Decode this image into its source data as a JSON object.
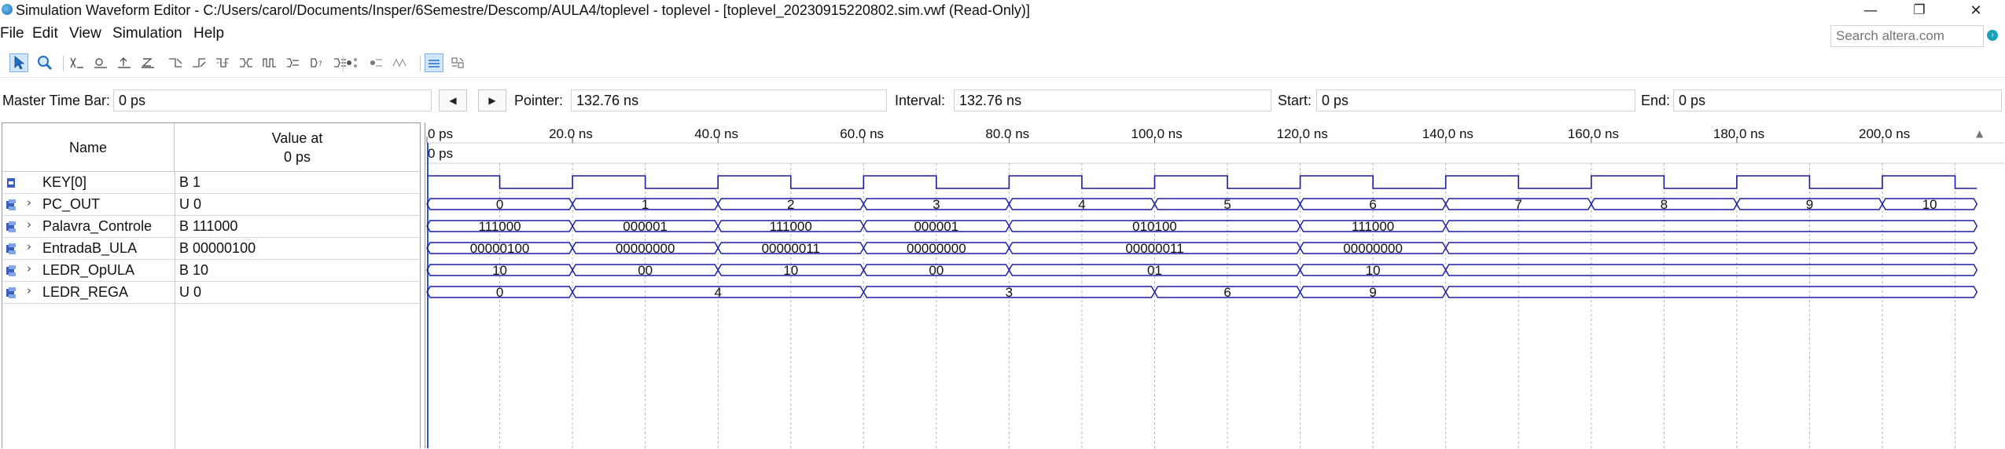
{
  "window": {
    "title": "Simulation Waveform Editor - C:/Users/carol/Documents/Insper/6Semestre/Descomp/AULA4/toplevel - toplevel - [toplevel_20230915220802.sim.vwf (Read-Only)]",
    "minimize": "—",
    "maximize": "❐",
    "close": "✕"
  },
  "menu": [
    "File",
    "Edit",
    "View",
    "Simulation",
    "Help"
  ],
  "search": {
    "placeholder": "Search altera.com"
  },
  "toolbar": {
    "icons": [
      "selection-tool-icon",
      "zoom-tool-icon",
      "forcing-unknown-icon",
      "forcing-low-icon",
      "forcing-high-icon",
      "forcing-high-impedance-icon",
      "weak-low-icon",
      "weak-high-icon",
      "invert-icon",
      "count-value-icon",
      "clock-icon",
      "random-values-icon",
      "value-icon",
      "snap-to-grid-icon",
      "grid-icon",
      "waveform-compare-icon",
      "settings-icon",
      "report-icon"
    ]
  },
  "timebar": {
    "master_label": "Master Time Bar:",
    "master_value": "0 ps",
    "prev": "◀",
    "next": "▶",
    "pointer_label": "Pointer:",
    "pointer_value": "132.76 ns",
    "interval_label": "Interval:",
    "interval_value": "132.76 ns",
    "start_label": "Start:",
    "start_value": "0 ps",
    "end_label": "End:",
    "end_value": "0 ps"
  },
  "signals_header": {
    "name": "Name",
    "value_line1": "Value at",
    "value_line2": "0 ps"
  },
  "signals": [
    {
      "name": "KEY[0]",
      "value": "B 1",
      "expandable": false,
      "icon": "input-pin-icon"
    },
    {
      "name": "PC_OUT",
      "value": "U 0",
      "expandable": true,
      "icon": "output-bus-icon"
    },
    {
      "name": "Palavra_Controle",
      "value": "B 111000",
      "expandable": true,
      "icon": "output-bus-icon"
    },
    {
      "name": "EntradaB_ULA",
      "value": "B 00000100",
      "expandable": true,
      "icon": "output-bus-icon"
    },
    {
      "name": "LEDR_OpULA",
      "value": "B 10",
      "expandable": true,
      "icon": "output-bus-icon"
    },
    {
      "name": "LEDR_REGA",
      "value": "U 0",
      "expandable": true,
      "icon": "output-bus-icon"
    }
  ],
  "timeline": {
    "ticks": [
      "0 ps",
      "20.0 ns",
      "40.0 ns",
      "60.0 ns",
      "80.0 ns",
      "100.0 ns",
      "120.0 ns",
      "140.0 ns",
      "160.0 ns",
      "180.0 ns",
      "200.0 ns"
    ],
    "tick_values_ns": [
      0,
      20,
      40,
      60,
      80,
      100,
      120,
      140,
      160,
      180,
      200
    ],
    "master_marker": "0 ps",
    "max_ns": 213
  },
  "waves": {
    "clock": {
      "period_ns": 20,
      "high_first_ns": 10,
      "start_level": 1
    },
    "buses": [
      {
        "name": "PC_OUT",
        "segments": [
          {
            "start": 0,
            "end": 20,
            "label": "0"
          },
          {
            "start": 20,
            "end": 40,
            "label": "1"
          },
          {
            "start": 40,
            "end": 60,
            "label": "2"
          },
          {
            "start": 60,
            "end": 80,
            "label": "3"
          },
          {
            "start": 80,
            "end": 100,
            "label": "4"
          },
          {
            "start": 100,
            "end": 120,
            "label": "5"
          },
          {
            "start": 120,
            "end": 140,
            "label": "6"
          },
          {
            "start": 140,
            "end": 160,
            "label": "7"
          },
          {
            "start": 160,
            "end": 180,
            "label": "8"
          },
          {
            "start": 180,
            "end": 200,
            "label": "9"
          },
          {
            "start": 200,
            "end": 213,
            "label": "10"
          }
        ]
      },
      {
        "name": "Palavra_Controle",
        "segments": [
          {
            "start": 0,
            "end": 20,
            "label": "111000"
          },
          {
            "start": 20,
            "end": 40,
            "label": "000001"
          },
          {
            "start": 40,
            "end": 60,
            "label": "111000"
          },
          {
            "start": 60,
            "end": 80,
            "label": "000001"
          },
          {
            "start": 80,
            "end": 120,
            "label": "010100"
          },
          {
            "start": 120,
            "end": 140,
            "label": "111000"
          },
          {
            "start": 140,
            "end": 213,
            "label": ""
          }
        ]
      },
      {
        "name": "EntradaB_ULA",
        "segments": [
          {
            "start": 0,
            "end": 20,
            "label": "00000100"
          },
          {
            "start": 20,
            "end": 40,
            "label": "00000000"
          },
          {
            "start": 40,
            "end": 60,
            "label": "00000011"
          },
          {
            "start": 60,
            "end": 80,
            "label": "00000000"
          },
          {
            "start": 80,
            "end": 120,
            "label": "00000011"
          },
          {
            "start": 120,
            "end": 140,
            "label": "00000000"
          },
          {
            "start": 140,
            "end": 213,
            "label": ""
          }
        ]
      },
      {
        "name": "LEDR_OpULA",
        "segments": [
          {
            "start": 0,
            "end": 20,
            "label": "10"
          },
          {
            "start": 20,
            "end": 40,
            "label": "00"
          },
          {
            "start": 40,
            "end": 60,
            "label": "10"
          },
          {
            "start": 60,
            "end": 80,
            "label": "00"
          },
          {
            "start": 80,
            "end": 120,
            "label": "01"
          },
          {
            "start": 120,
            "end": 140,
            "label": "10"
          },
          {
            "start": 140,
            "end": 213,
            "label": ""
          }
        ]
      },
      {
        "name": "LEDR_REGA",
        "segments": [
          {
            "start": 0,
            "end": 20,
            "label": "0"
          },
          {
            "start": 20,
            "end": 60,
            "label": "4"
          },
          {
            "start": 60,
            "end": 100,
            "label": "3"
          },
          {
            "start": 100,
            "end": 120,
            "label": "6"
          },
          {
            "start": 120,
            "end": 140,
            "label": "9"
          },
          {
            "start": 140,
            "end": 213,
            "label": ""
          }
        ]
      }
    ]
  },
  "colors": {
    "wave": "#1a1aa0",
    "grid": "#b5b5b5",
    "cursor": "#2b55c9",
    "text": "#111111"
  }
}
